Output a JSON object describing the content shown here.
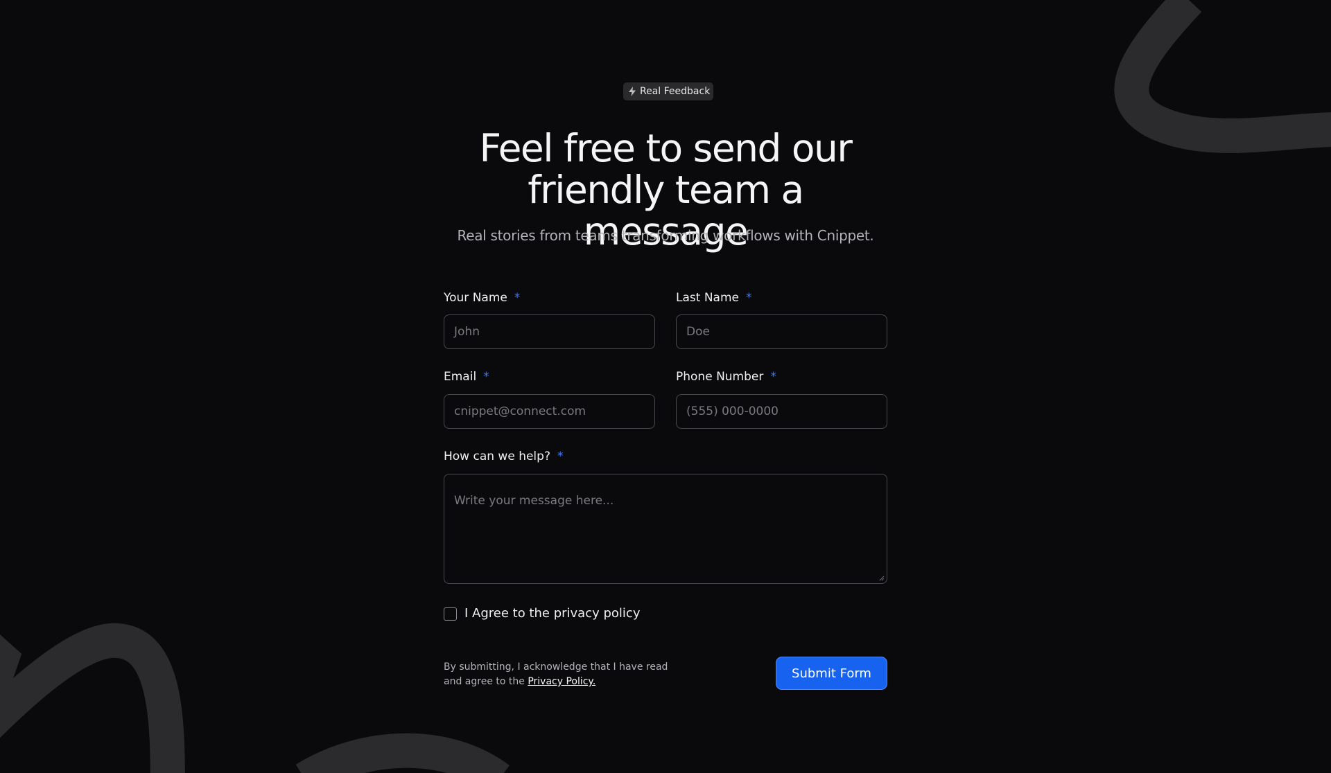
{
  "badge": {
    "icon": "lightning-bolt-icon",
    "label": "Real Feedback"
  },
  "hero": {
    "title_line1": "Feel free to send our",
    "title_line2": "friendly team a message",
    "subtitle": "Real stories from teams transforming workflows with Cnippet."
  },
  "form": {
    "required_marker": "*",
    "first_name": {
      "label": "Your Name",
      "placeholder": "John",
      "value": ""
    },
    "last_name": {
      "label": "Last Name",
      "placeholder": "Doe",
      "value": ""
    },
    "email": {
      "label": "Email",
      "placeholder": "cnippet@connect.com",
      "value": ""
    },
    "phone": {
      "label": "Phone Number",
      "placeholder": "(555) 000-0000",
      "value": ""
    },
    "message": {
      "label": "How can we help?",
      "placeholder": "Write your message here...",
      "value": ""
    },
    "privacy_checkbox": {
      "label": "I Agree to the privacy policy",
      "checked": false
    },
    "disclaimer": {
      "text": "By submitting, I acknowledge that I have read and agree to the ",
      "link_text": "Privacy Policy."
    },
    "submit_label": "Submit Form"
  },
  "colors": {
    "background": "#0a0a0c",
    "accent": "#1763f0",
    "required": "#3b7bff",
    "decoration": "#2b2b2e"
  }
}
